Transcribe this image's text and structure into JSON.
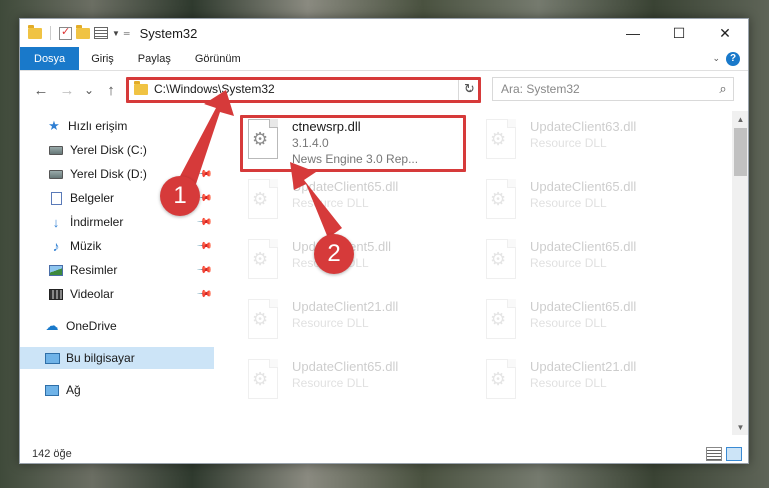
{
  "window": {
    "title": "System32",
    "controls": {
      "minimize": "—",
      "maximize": "☐",
      "close": "✕"
    }
  },
  "ribbon": {
    "tabs": [
      {
        "label": "Dosya",
        "active": true
      },
      {
        "label": "Giriş"
      },
      {
        "label": "Paylaş"
      },
      {
        "label": "Görünüm"
      }
    ],
    "help": "?"
  },
  "nav": {
    "back": "←",
    "forward": "→",
    "recent": "⌄",
    "up": "↑"
  },
  "address": {
    "path": "C:\\Windows\\System32",
    "refresh": "↻",
    "dropdown": "⌄"
  },
  "search": {
    "placeholder": "Ara: System32",
    "icon": "⌕"
  },
  "sidebar": {
    "items": [
      {
        "label": "Hızlı erişim",
        "icon": "star-icon"
      },
      {
        "label": "Yerel Disk (C:)",
        "icon": "disk-icon"
      },
      {
        "label": "Yerel Disk (D:)",
        "icon": "disk-icon",
        "pinned": true
      },
      {
        "label": "Belgeler",
        "icon": "documents-icon",
        "pinned": true
      },
      {
        "label": "İndirmeler",
        "icon": "downloads-icon",
        "pinned": true
      },
      {
        "label": "Müzik",
        "icon": "music-icon",
        "pinned": true
      },
      {
        "label": "Resimler",
        "icon": "pictures-icon",
        "pinned": true
      },
      {
        "label": "Videolar",
        "icon": "videos-icon",
        "pinned": true
      },
      {
        "label": "OneDrive",
        "icon": "onedrive-icon"
      },
      {
        "label": "Bu bilgisayar",
        "icon": "computer-icon",
        "selected": true
      },
      {
        "label": "Ağ",
        "icon": "network-icon"
      }
    ]
  },
  "files": {
    "main": {
      "name": "ctnewsrp.dll",
      "version": "3.1.4.0",
      "description": "News Engine 3.0 Rep..."
    },
    "others": [
      {
        "name": "UpdateClient63.dll",
        "desc": "Resource DLL"
      },
      {
        "name": "UpdateClient65.dll",
        "desc": "Resource DLL"
      },
      {
        "name": "UpdateClient65.dll",
        "desc": "Resource DLL"
      },
      {
        "name": "UpdateClient5.dll",
        "desc": "Resource DLL"
      },
      {
        "name": "UpdateClient65.dll",
        "desc": "Resource DLL"
      },
      {
        "name": "UpdateClient21.dll",
        "desc": "Resource DLL"
      },
      {
        "name": "UpdateClient65.dll",
        "desc": "Resource DLL"
      },
      {
        "name": "UpdateClient65.dll",
        "desc": "Resource DLL"
      },
      {
        "name": "UpdateClient21.dll",
        "desc": "Resource DLL"
      }
    ]
  },
  "status": {
    "count": "142 öğe"
  },
  "callouts": {
    "one": "1",
    "two": "2"
  },
  "colors": {
    "accent": "#1979ca",
    "annotation": "#d63a3a",
    "selection": "#cce4f7"
  }
}
